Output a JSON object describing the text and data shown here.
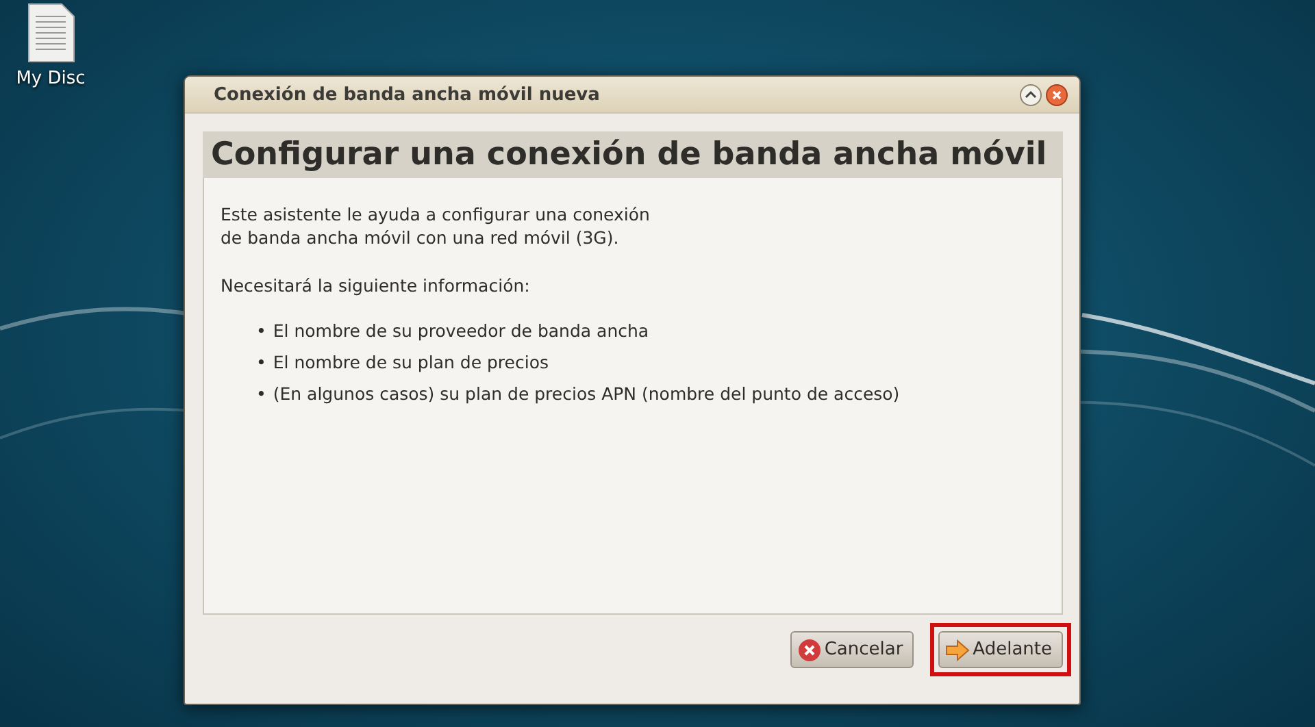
{
  "desktop": {
    "icons": [
      {
        "label": "My Disc"
      }
    ]
  },
  "window": {
    "title": "Conexión de banda ancha móvil nueva"
  },
  "header": "Configurar una conexión de banda ancha móvil",
  "intro": [
    "Este asistente le ayuda a configurar una conexión",
    "de banda ancha móvil con una red móvil (3G)."
  ],
  "info_heading": "Necesitará la siguiente información:",
  "bullets": [
    {
      "marker": "•",
      "text": "El nombre de su proveedor de banda ancha"
    },
    {
      "marker": "•",
      "text": "El nombre de su plan de precios"
    },
    {
      "marker": "•",
      "text": "(En algunos casos) su plan de precios APN (nombre del punto de acceso)"
    }
  ],
  "buttons": [
    {
      "kind": "cancel",
      "label": "Cancelar",
      "highlighted": false
    },
    {
      "kind": "forward",
      "label": "Adelante",
      "highlighted": true
    }
  ]
}
